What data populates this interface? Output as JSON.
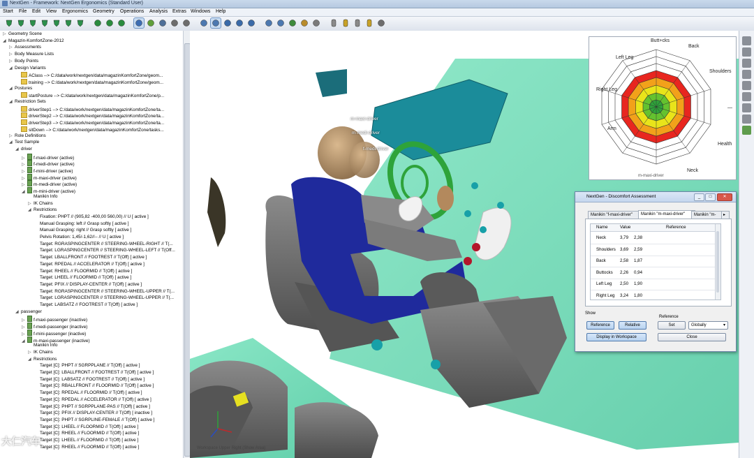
{
  "window": {
    "title": "NextGen - Framework: NextGen Ergonomics (Standard User)"
  },
  "menu": [
    "Start",
    "File",
    "Edit",
    "View",
    "Ergonomics",
    "Geometry",
    "Operations",
    "Analysis",
    "Extras",
    "Windows",
    "Help"
  ],
  "tree": [
    {
      "d": 0,
      "e": "▷",
      "t": "Geometry Scene"
    },
    {
      "d": 0,
      "e": "◢",
      "t": "Magazin-KomfortZone-2012"
    },
    {
      "d": 1,
      "e": "▷",
      "t": "Assessments"
    },
    {
      "d": 1,
      "e": "▷",
      "t": "Body Measure Lists"
    },
    {
      "d": 1,
      "e": "▷",
      "t": "Body Points"
    },
    {
      "d": 1,
      "e": "◢",
      "t": "Design Variants"
    },
    {
      "d": 2,
      "e": "",
      "i": "f",
      "t": "AClass --> C:/data/work/nextgen/data/magazinKomfortZone/geom..."
    },
    {
      "d": 2,
      "e": "",
      "i": "f",
      "t": "training --> C:/data/work/nextgen/data/magazinKomfortZone/geom..."
    },
    {
      "d": 1,
      "e": "◢",
      "t": "Postures"
    },
    {
      "d": 2,
      "e": "",
      "i": "f",
      "t": "startPosture --> C:/data/work/nextgen/data/magazinKomfortZone/p..."
    },
    {
      "d": 1,
      "e": "◢",
      "t": "Restriction Sets"
    },
    {
      "d": 2,
      "e": "",
      "i": "f",
      "t": "driverStep1 --> C:/data/work/nextgen/data/magazinKomfortZone/ta..."
    },
    {
      "d": 2,
      "e": "",
      "i": "f",
      "t": "driverStep2 --> C:/data/work/nextgen/data/magazinKomfortZone/ta..."
    },
    {
      "d": 2,
      "e": "",
      "i": "f",
      "t": "driverStep3 --> C:/data/work/nextgen/data/magazinKomfortZone/ta..."
    },
    {
      "d": 2,
      "e": "",
      "i": "f",
      "t": "sitDown --> C:/data/work/nextgen/data/magazinKomfortZone/tasks..."
    },
    {
      "d": 1,
      "e": "▷",
      "t": "Role Definitions"
    },
    {
      "d": 1,
      "e": "◢",
      "t": "Test Sample"
    },
    {
      "d": 2,
      "e": "◢",
      "t": "driver"
    },
    {
      "d": 3,
      "e": "▷",
      "i": "m",
      "t": "f-maxi-driver (active)"
    },
    {
      "d": 3,
      "e": "▷",
      "i": "m",
      "t": "f-medi-driver (active)"
    },
    {
      "d": 3,
      "e": "▷",
      "i": "m",
      "t": "f-mini-driver (active)"
    },
    {
      "d": 3,
      "e": "▷",
      "i": "m",
      "t": "m-maxi-driver (active)"
    },
    {
      "d": 3,
      "e": "▷",
      "i": "m",
      "t": "m-medi-driver (active)"
    },
    {
      "d": 3,
      "e": "◢",
      "i": "m",
      "t": "m-mini-driver (active)"
    },
    {
      "d": 4,
      "e": "",
      "t": "Manikin Info"
    },
    {
      "d": 4,
      "e": "▷",
      "t": "IK Chains"
    },
    {
      "d": 4,
      "e": "◢",
      "t": "Restrictions"
    },
    {
      "d": 5,
      "e": "",
      "t": "Fixation: PHPT // (905,82 -400,00 560,00) // U [ active ]"
    },
    {
      "d": 5,
      "e": "",
      "t": "Manual Grasping: left // Grasp softly [ active ]"
    },
    {
      "d": 5,
      "e": "",
      "t": "Manual Grasping: right // Grasp softly [ active ]"
    },
    {
      "d": 5,
      "e": "",
      "t": "Pelvis Rotation: 1,45/-1,62//-- // U [ active ]"
    },
    {
      "d": 5,
      "e": "",
      "t": "Target: RGRASPINGCENTER // STEERING-WHEEL-RIGHT // T(..."
    },
    {
      "d": 5,
      "e": "",
      "t": "Target: LGRASPINGCENTER // STEERING-WHEEL-LEFT // T(Off..."
    },
    {
      "d": 5,
      "e": "",
      "t": "Target: LBALLFRONT // FOOTREST // T(Off) [ active ]"
    },
    {
      "d": 5,
      "e": "",
      "t": "Target: RPEDAL // ACCELERATOR // T(Off) [ active ]"
    },
    {
      "d": 5,
      "e": "",
      "t": "Target: RHEEL // FLOORMID // T(Off) [ active ]"
    },
    {
      "d": 5,
      "e": "",
      "t": "Target: LHEEL // FLOORMID // T(Off) [ active ]"
    },
    {
      "d": 5,
      "e": "",
      "t": "Target: PFIX // DISPLAY-CENTER // T(Off) [ active ]"
    },
    {
      "d": 5,
      "e": "",
      "t": "Target: RGRASPINGCENTER // STEERING-WHEEL-UPPER // T(..."
    },
    {
      "d": 5,
      "e": "",
      "t": "Target: LGRASPINGCENTER // STEERING-WHEEL-UPPER // T(..."
    },
    {
      "d": 5,
      "e": "",
      "t": "Target: LABSATZ // FOOTREST // T(Off) [ active ]"
    },
    {
      "d": 2,
      "e": "◢",
      "t": "passenger"
    },
    {
      "d": 3,
      "e": "▷",
      "i": "m",
      "t": "f-maxi-passenger (inactive)"
    },
    {
      "d": 3,
      "e": "▷",
      "i": "m",
      "t": "f-medi-passenger (inactive)"
    },
    {
      "d": 3,
      "e": "▷",
      "i": "m",
      "t": "f-mini-passenger (inactive)"
    },
    {
      "d": 3,
      "e": "◢",
      "i": "m",
      "t": "m-maxi-passenger (inactive)"
    },
    {
      "d": 4,
      "e": "",
      "t": "Manikin Info"
    },
    {
      "d": 4,
      "e": "▷",
      "t": "IK Chains"
    },
    {
      "d": 4,
      "e": "◢",
      "t": "Restrictions"
    },
    {
      "d": 5,
      "e": "",
      "t": "Target [C]: PHPT // SGRPPLANE // T(Off) [ active ]"
    },
    {
      "d": 5,
      "e": "",
      "t": "Target [C]: LBALLFRONT // FOOTREST // T(Off) [ active ]"
    },
    {
      "d": 5,
      "e": "",
      "t": "Target [C]: LABSATZ // FOOTREST // T(Off) [ active ]"
    },
    {
      "d": 5,
      "e": "",
      "t": "Target [C]: RBALLFRONT // FLOORMID // T(Off) [ active ]"
    },
    {
      "d": 5,
      "e": "",
      "t": "Target [C]: RPEDAL // FLOORMID // T(Off) [ active ]"
    },
    {
      "d": 5,
      "e": "",
      "t": "Target [C]: RPEDAL // ACCELERATOR // T(Off) [ active ]"
    },
    {
      "d": 5,
      "e": "",
      "t": "Target [C]: PHPT // SGRPPLANE-PAS // T(Off) [ active ]"
    },
    {
      "d": 5,
      "e": "",
      "t": "Target [C]: PFIX // DISPLAY-CENTER // T(Off) [ inactive ]"
    },
    {
      "d": 5,
      "e": "",
      "t": "Target [C]: PHPT // SGRPLINE-FEMALE // T(Off) [ active ]"
    },
    {
      "d": 5,
      "e": "",
      "t": "Target [C]: LHEEL // FLOORMID // T(Off) [ active ]"
    },
    {
      "d": 5,
      "e": "",
      "t": "Target [C]: RHEEL // FLOORMID // T(Off) [ active ]"
    },
    {
      "d": 5,
      "e": "",
      "t": "Target [C]: LHEEL // FLOORMID // T(Off) [ active ]"
    },
    {
      "d": 5,
      "e": "",
      "t": "Target [C]: RHEEL // FLOORMID // T(Off) [ active ]"
    }
  ],
  "radar": {
    "labels": [
      "Butt+cks",
      "Back",
      "Shoulders",
      "—",
      "Health",
      "Neck",
      "Left Leg",
      "Right Leg",
      "Arm"
    ],
    "extra_label": "m-maxi-driver"
  },
  "viewport": {
    "labels": [
      "m-maxi-driver",
      "m-medi-driver",
      "f-medi-driver"
    ],
    "status": "Workspace Upper Right (Show Area)"
  },
  "dialog": {
    "title": "NextGen - Discomfort Assessment",
    "tabs": [
      "Manikin \"f-maxi-driver\"",
      "Manikin \"m-maxi-driver\"",
      "Manikin \"m-"
    ],
    "headers": {
      "name": "Name",
      "value": "Value",
      "reference": "Reference"
    },
    "rows": [
      {
        "name": "Neck",
        "value": "3,79",
        "ref": "2,38"
      },
      {
        "name": "Shoulders",
        "value": "3,69",
        "ref": "2,59"
      },
      {
        "name": "Back",
        "value": "2,58",
        "ref": "1,87"
      },
      {
        "name": "Buttocks",
        "value": "2,26",
        "ref": "0,94"
      },
      {
        "name": "Left Leg",
        "value": "2,50",
        "ref": "1,90"
      },
      {
        "name": "Right Leg",
        "value": "3,24",
        "ref": "1,80"
      }
    ],
    "show_label": "Show",
    "reference_label": "Reference",
    "btn_reference": "Reference",
    "btn_relative": "Relative",
    "btn_set": "Set",
    "select_globally": "Globally",
    "btn_display": "Display in Workspace",
    "btn_close": "Close"
  },
  "watermark": "大仁汽车",
  "colors": {
    "floor": "#66d9b0",
    "dashboard": "#1b8c9a",
    "body_blue": "#1f2a9c",
    "wheel": "#2ea33a",
    "seat": "#6a6a6a"
  }
}
